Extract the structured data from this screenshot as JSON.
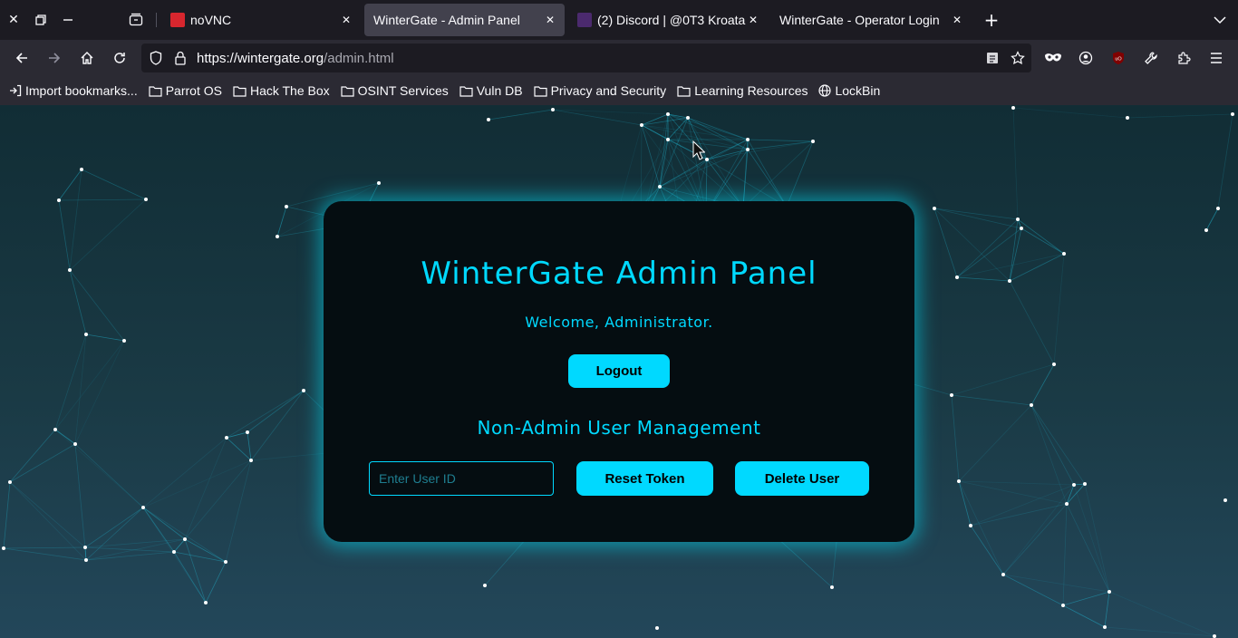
{
  "browser": {
    "tabs": [
      {
        "title": "noVNC",
        "active": false
      },
      {
        "title": "WinterGate - Admin Panel",
        "active": true
      },
      {
        "title": "(2) Discord | @0T3 Kroata",
        "active": false
      },
      {
        "title": "WinterGate - Operator Login",
        "active": false
      }
    ],
    "url_host": "https://wintergate.org",
    "url_path": "/admin.html",
    "bookmarks": [
      {
        "label": "Import bookmarks...",
        "icon": "import-icon"
      },
      {
        "label": "Parrot OS",
        "icon": "folder-icon"
      },
      {
        "label": "Hack The Box",
        "icon": "folder-icon"
      },
      {
        "label": "OSINT Services",
        "icon": "folder-icon"
      },
      {
        "label": "Vuln DB",
        "icon": "folder-icon"
      },
      {
        "label": "Privacy and Security",
        "icon": "folder-icon"
      },
      {
        "label": "Learning Resources",
        "icon": "folder-icon"
      },
      {
        "label": "LockBin",
        "icon": "globe-icon"
      }
    ]
  },
  "panel": {
    "title": "WinterGate Admin Panel",
    "welcome": "Welcome, Administrator.",
    "logout_label": "Logout",
    "section_title": "Non-Admin User Management",
    "userid_placeholder": "Enter User ID",
    "userid_value": "",
    "reset_label": "Reset Token",
    "delete_label": "Delete User"
  },
  "colors": {
    "accent": "#00d9ff",
    "panel_bg": "#050d11",
    "page_bg": "#1a3a45"
  }
}
